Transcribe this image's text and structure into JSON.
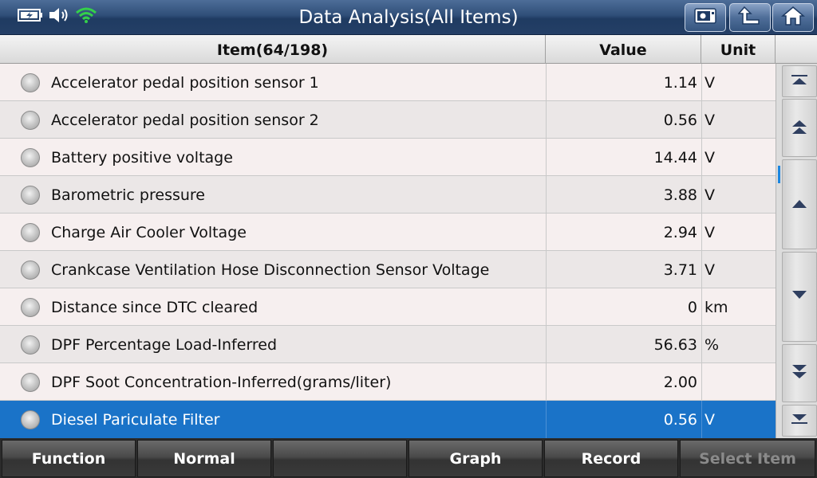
{
  "header": {
    "title": "Data Analysis(All Items)",
    "buttons": [
      "screen-capture-icon",
      "back-icon",
      "home-icon"
    ],
    "status_icons": [
      "battery-icon",
      "volume-icon",
      "wifi-icon"
    ]
  },
  "table": {
    "columns": {
      "item": "Item(64/198)",
      "value": "Value",
      "unit": "Unit"
    },
    "rows": [
      {
        "name": "Accelerator pedal position sensor 1",
        "value": "1.14",
        "unit": "V"
      },
      {
        "name": "Accelerator pedal position sensor 2",
        "value": "0.56",
        "unit": "V"
      },
      {
        "name": "Battery positive voltage",
        "value": "14.44",
        "unit": "V"
      },
      {
        "name": "Barometric pressure",
        "value": "3.88",
        "unit": "V"
      },
      {
        "name": "Charge Air Cooler Voltage",
        "value": "2.94",
        "unit": "V"
      },
      {
        "name": "Crankcase Ventilation Hose Disconnection Sensor Voltage",
        "value": "3.71",
        "unit": "V"
      },
      {
        "name": "Distance since DTC cleared",
        "value": "0",
        "unit": "km"
      },
      {
        "name": "DPF Percentage Load-Inferred",
        "value": "56.63",
        "unit": "%"
      },
      {
        "name": "DPF Soot Concentration-Inferred(grams/liter)",
        "value": "2.00",
        "unit": ""
      },
      {
        "name": "Diesel Pariculate Filter",
        "value": "0.56",
        "unit": "V"
      }
    ],
    "selected_index": 9
  },
  "toolbar": {
    "function": "Function",
    "normal": "Normal",
    "empty": "",
    "graph": "Graph",
    "record": "Record",
    "select_item": "Select Item"
  },
  "colors": {
    "accent": "#1a73c8",
    "title_bar": "#2f4e78"
  }
}
